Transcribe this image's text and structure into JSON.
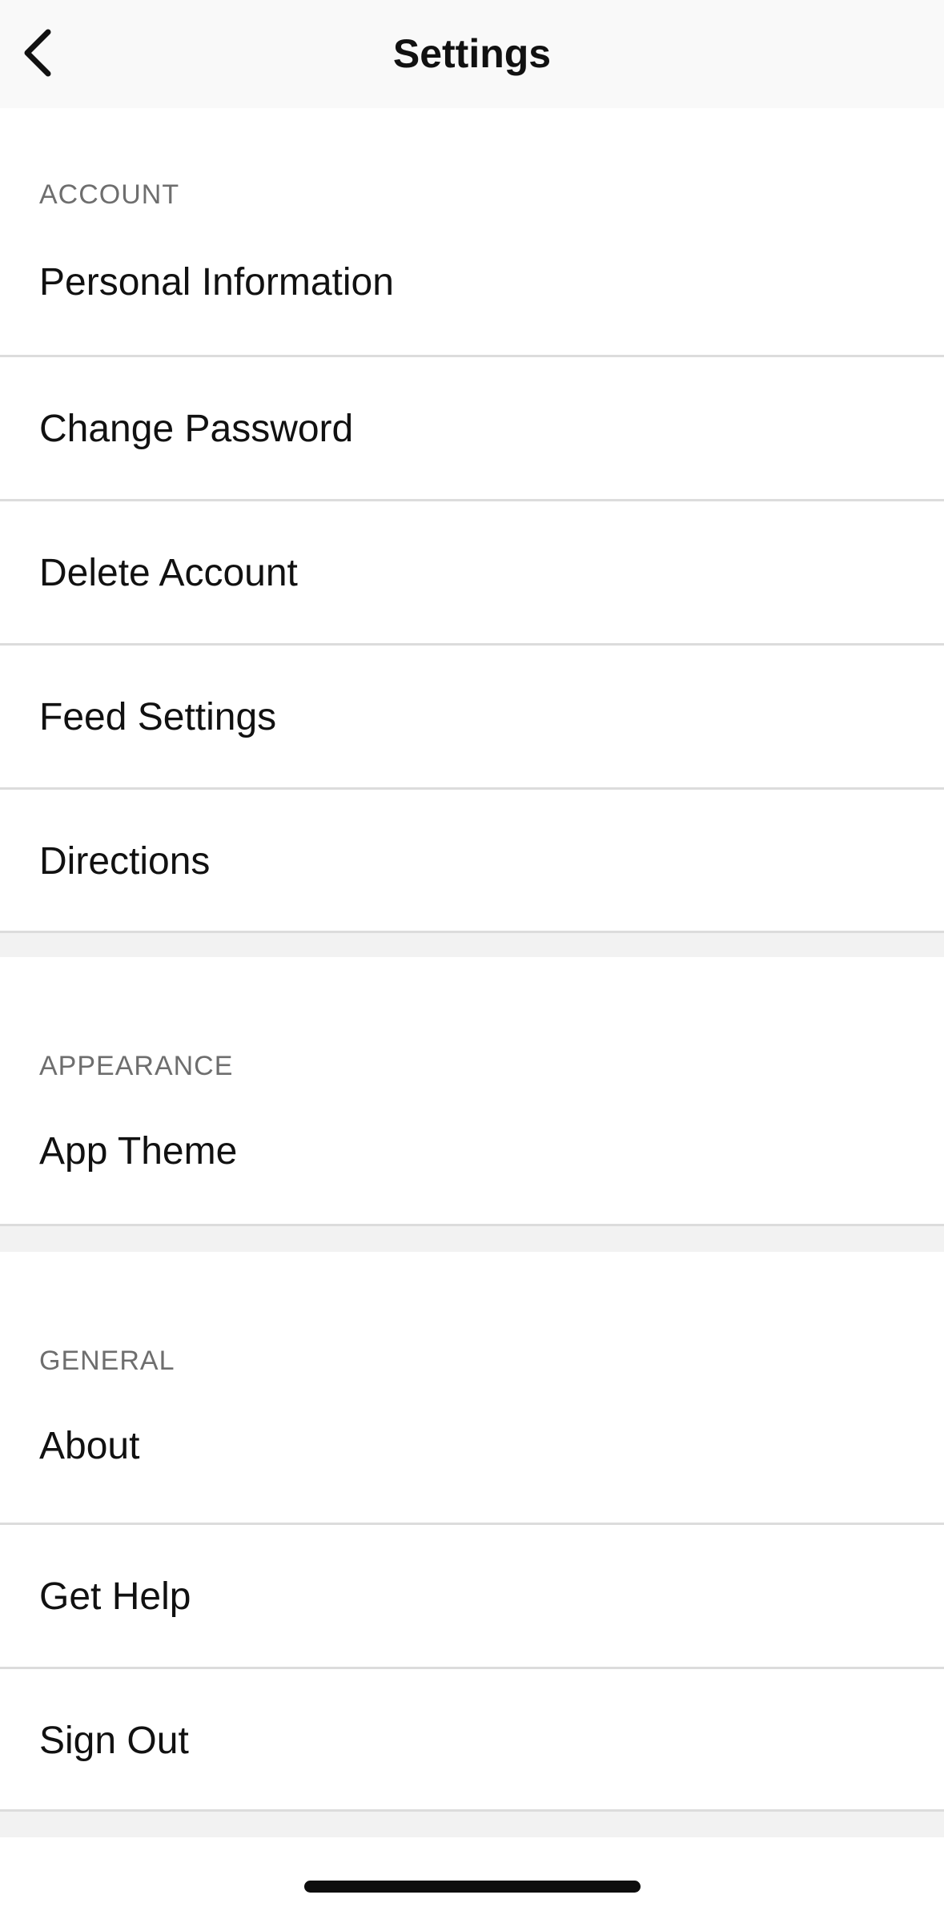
{
  "header": {
    "title": "Settings",
    "back_icon": "chevron-left-icon"
  },
  "sections": {
    "account": {
      "title": "ACCOUNT",
      "items": [
        {
          "label": "Personal Information"
        },
        {
          "label": "Change Password"
        },
        {
          "label": "Delete Account"
        },
        {
          "label": "Feed Settings"
        },
        {
          "label": "Directions"
        }
      ]
    },
    "appearance": {
      "title": "APPEARANCE",
      "items": [
        {
          "label": "App Theme"
        }
      ]
    },
    "general": {
      "title": "GENERAL",
      "items": [
        {
          "label": "About"
        },
        {
          "label": "Get Help"
        },
        {
          "label": "Sign Out"
        }
      ]
    }
  },
  "colors": {
    "background": "#f2f2f2",
    "card": "#ffffff",
    "separator": "#dcdcdc",
    "section_header": "#6e6e6e",
    "text": "#111111"
  }
}
